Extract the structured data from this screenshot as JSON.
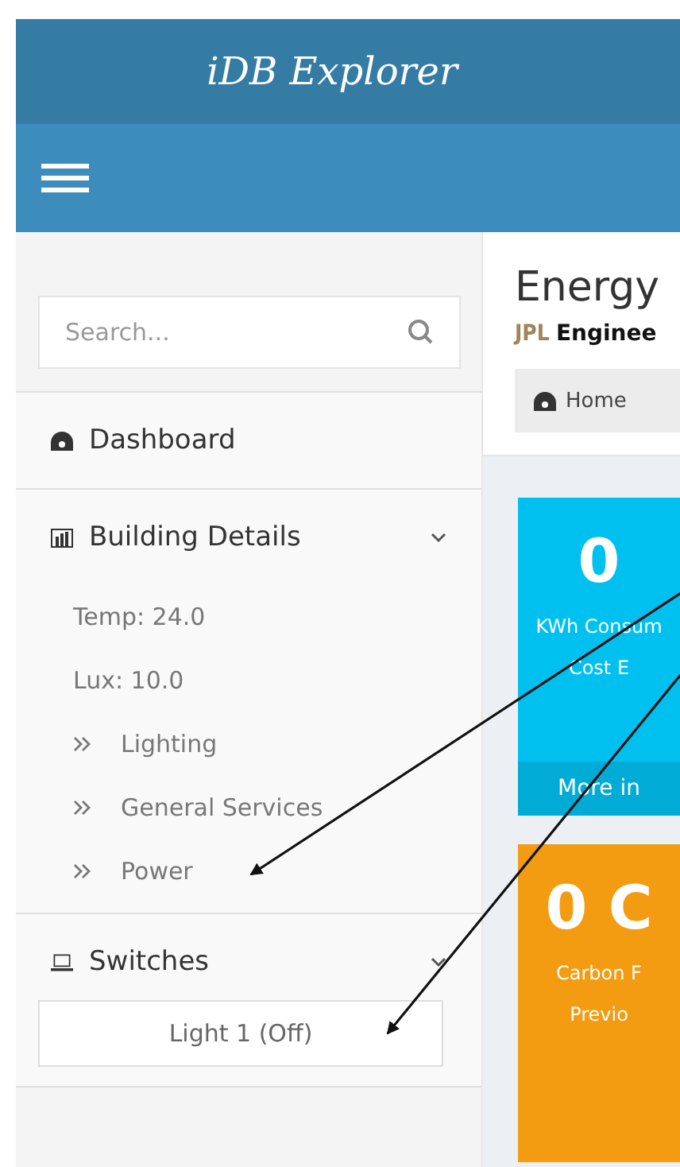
{
  "header": {
    "title": "iDB Explorer"
  },
  "sidebar": {
    "search": {
      "placeholder": "Search..."
    },
    "items": [
      {
        "kind": "link",
        "label": "Dashboard"
      },
      {
        "kind": "group",
        "label": "Building Details",
        "expanded": true,
        "readings": [
          "Temp: 24.0",
          "Lux: 10.0"
        ],
        "children": [
          "Lighting",
          "General Services",
          "Power"
        ]
      },
      {
        "kind": "switches",
        "label": "Switches",
        "expanded": true,
        "buttons": [
          "Light 1 (Off)"
        ]
      }
    ]
  },
  "content": {
    "title": "Energy",
    "subtitle_mark": "JPL",
    "subtitle": "Enginee",
    "breadcrumb": "Home",
    "cards": [
      {
        "color": "#00c0ef",
        "value": "0",
        "lines": [
          "KWh Consum",
          "Cost E"
        ],
        "footer": "More in"
      },
      {
        "color": "#f39c12",
        "value": "0 C",
        "lines": [
          "Carbon F",
          "Previo"
        ]
      }
    ]
  },
  "annotations": [
    {
      "kind": "arrow"
    },
    {
      "kind": "arrow"
    }
  ]
}
